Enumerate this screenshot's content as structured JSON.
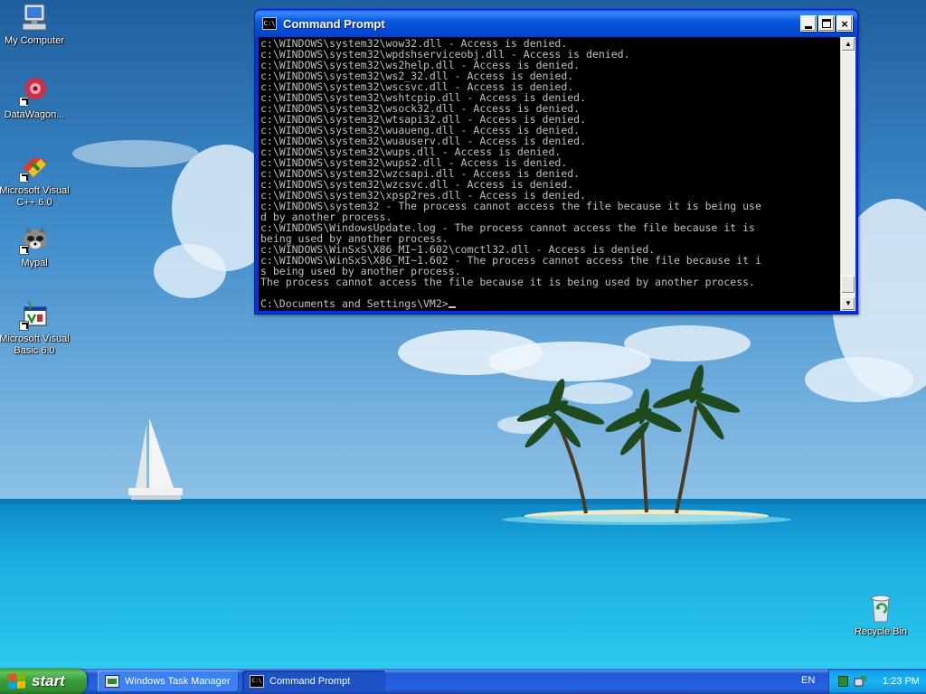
{
  "desktop": {
    "icons": [
      {
        "label": "My Computer",
        "icon": "my-computer-icon"
      },
      {
        "label": "DataWagon...",
        "icon": "datawagon-icon"
      },
      {
        "label": "Microsoft Visual C++ 6.0",
        "icon": "visual-cpp-icon"
      },
      {
        "label": "Mypal",
        "icon": "mypal-raccoon-icon"
      },
      {
        "label": "Microsoft Visual Basic 6.0",
        "icon": "visual-basic-icon"
      },
      {
        "label": "Recycle Bin",
        "icon": "recycle-bin-icon"
      }
    ]
  },
  "window": {
    "title": "Command Prompt",
    "title_icon_text": "C:\\",
    "buttons": {
      "minimize": "minimize",
      "maximize": "maximize",
      "close": "×"
    }
  },
  "console": {
    "lines": [
      "c:\\WINDOWS\\system32\\wow32.dll - Access is denied.",
      "c:\\WINDOWS\\system32\\wpdshserviceobj.dll - Access is denied.",
      "c:\\WINDOWS\\system32\\ws2help.dll - Access is denied.",
      "c:\\WINDOWS\\system32\\ws2_32.dll - Access is denied.",
      "c:\\WINDOWS\\system32\\wscsvc.dll - Access is denied.",
      "c:\\WINDOWS\\system32\\wshtcpip.dll - Access is denied.",
      "c:\\WINDOWS\\system32\\wsock32.dll - Access is denied.",
      "c:\\WINDOWS\\system32\\wtsapi32.dll - Access is denied.",
      "c:\\WINDOWS\\system32\\wuaueng.dll - Access is denied.",
      "c:\\WINDOWS\\system32\\wuauserv.dll - Access is denied.",
      "c:\\WINDOWS\\system32\\wups.dll - Access is denied.",
      "c:\\WINDOWS\\system32\\wups2.dll - Access is denied.",
      "c:\\WINDOWS\\system32\\wzcsapi.dll - Access is denied.",
      "c:\\WINDOWS\\system32\\wzcsvc.dll - Access is denied.",
      "c:\\WINDOWS\\system32\\xpsp2res.dll - Access is denied.",
      "c:\\WINDOWS\\system32 - The process cannot access the file because it is being use",
      "d by another process.",
      "c:\\WINDOWS\\WindowsUpdate.log - The process cannot access the file because it is",
      "being used by another process.",
      "c:\\WINDOWS\\WinSxS\\X86_MI~1.602\\comctl32.dll - Access is denied.",
      "c:\\WINDOWS\\WinSxS\\X86_MI~1.602 - The process cannot access the file because it i",
      "s being used by another process.",
      "The process cannot access the file because it is being used by another process.",
      ""
    ],
    "prompt": "C:\\Documents and Settings\\VM2>"
  },
  "scrollbar": {
    "up": "▲",
    "down": "▼"
  },
  "taskbar": {
    "start_label": "start",
    "tasks": [
      {
        "label": "Windows Task Manager",
        "icon": "task-manager-icon",
        "active": false
      },
      {
        "label": "Command Prompt",
        "icon": "command-prompt-icon",
        "active": true
      }
    ],
    "language": "EN",
    "clock": "1:23 PM"
  },
  "colors": {
    "console_bg": "#000000",
    "console_fg": "#c0c0c0",
    "titlebar": "#0758e0",
    "taskbar": "#245edb",
    "start_button": "#3aa03a"
  }
}
